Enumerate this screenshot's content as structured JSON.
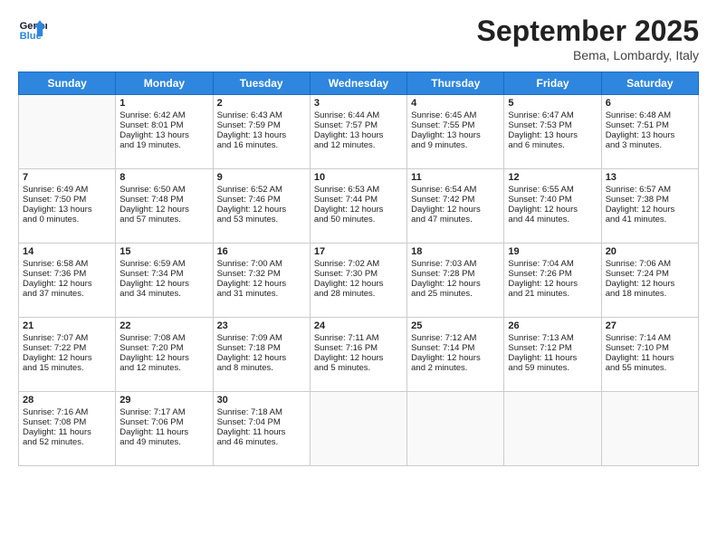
{
  "header": {
    "logo_line1": "General",
    "logo_line2": "Blue",
    "month": "September 2025",
    "location": "Bema, Lombardy, Italy"
  },
  "days_of_week": [
    "Sunday",
    "Monday",
    "Tuesday",
    "Wednesday",
    "Thursday",
    "Friday",
    "Saturday"
  ],
  "weeks": [
    [
      {
        "day": "",
        "content": ""
      },
      {
        "day": "1",
        "content": "Sunrise: 6:42 AM\nSunset: 8:01 PM\nDaylight: 13 hours\nand 19 minutes."
      },
      {
        "day": "2",
        "content": "Sunrise: 6:43 AM\nSunset: 7:59 PM\nDaylight: 13 hours\nand 16 minutes."
      },
      {
        "day": "3",
        "content": "Sunrise: 6:44 AM\nSunset: 7:57 PM\nDaylight: 13 hours\nand 12 minutes."
      },
      {
        "day": "4",
        "content": "Sunrise: 6:45 AM\nSunset: 7:55 PM\nDaylight: 13 hours\nand 9 minutes."
      },
      {
        "day": "5",
        "content": "Sunrise: 6:47 AM\nSunset: 7:53 PM\nDaylight: 13 hours\nand 6 minutes."
      },
      {
        "day": "6",
        "content": "Sunrise: 6:48 AM\nSunset: 7:51 PM\nDaylight: 13 hours\nand 3 minutes."
      }
    ],
    [
      {
        "day": "7",
        "content": "Sunrise: 6:49 AM\nSunset: 7:50 PM\nDaylight: 13 hours\nand 0 minutes."
      },
      {
        "day": "8",
        "content": "Sunrise: 6:50 AM\nSunset: 7:48 PM\nDaylight: 12 hours\nand 57 minutes."
      },
      {
        "day": "9",
        "content": "Sunrise: 6:52 AM\nSunset: 7:46 PM\nDaylight: 12 hours\nand 53 minutes."
      },
      {
        "day": "10",
        "content": "Sunrise: 6:53 AM\nSunset: 7:44 PM\nDaylight: 12 hours\nand 50 minutes."
      },
      {
        "day": "11",
        "content": "Sunrise: 6:54 AM\nSunset: 7:42 PM\nDaylight: 12 hours\nand 47 minutes."
      },
      {
        "day": "12",
        "content": "Sunrise: 6:55 AM\nSunset: 7:40 PM\nDaylight: 12 hours\nand 44 minutes."
      },
      {
        "day": "13",
        "content": "Sunrise: 6:57 AM\nSunset: 7:38 PM\nDaylight: 12 hours\nand 41 minutes."
      }
    ],
    [
      {
        "day": "14",
        "content": "Sunrise: 6:58 AM\nSunset: 7:36 PM\nDaylight: 12 hours\nand 37 minutes."
      },
      {
        "day": "15",
        "content": "Sunrise: 6:59 AM\nSunset: 7:34 PM\nDaylight: 12 hours\nand 34 minutes."
      },
      {
        "day": "16",
        "content": "Sunrise: 7:00 AM\nSunset: 7:32 PM\nDaylight: 12 hours\nand 31 minutes."
      },
      {
        "day": "17",
        "content": "Sunrise: 7:02 AM\nSunset: 7:30 PM\nDaylight: 12 hours\nand 28 minutes."
      },
      {
        "day": "18",
        "content": "Sunrise: 7:03 AM\nSunset: 7:28 PM\nDaylight: 12 hours\nand 25 minutes."
      },
      {
        "day": "19",
        "content": "Sunrise: 7:04 AM\nSunset: 7:26 PM\nDaylight: 12 hours\nand 21 minutes."
      },
      {
        "day": "20",
        "content": "Sunrise: 7:06 AM\nSunset: 7:24 PM\nDaylight: 12 hours\nand 18 minutes."
      }
    ],
    [
      {
        "day": "21",
        "content": "Sunrise: 7:07 AM\nSunset: 7:22 PM\nDaylight: 12 hours\nand 15 minutes."
      },
      {
        "day": "22",
        "content": "Sunrise: 7:08 AM\nSunset: 7:20 PM\nDaylight: 12 hours\nand 12 minutes."
      },
      {
        "day": "23",
        "content": "Sunrise: 7:09 AM\nSunset: 7:18 PM\nDaylight: 12 hours\nand 8 minutes."
      },
      {
        "day": "24",
        "content": "Sunrise: 7:11 AM\nSunset: 7:16 PM\nDaylight: 12 hours\nand 5 minutes."
      },
      {
        "day": "25",
        "content": "Sunrise: 7:12 AM\nSunset: 7:14 PM\nDaylight: 12 hours\nand 2 minutes."
      },
      {
        "day": "26",
        "content": "Sunrise: 7:13 AM\nSunset: 7:12 PM\nDaylight: 11 hours\nand 59 minutes."
      },
      {
        "day": "27",
        "content": "Sunrise: 7:14 AM\nSunset: 7:10 PM\nDaylight: 11 hours\nand 55 minutes."
      }
    ],
    [
      {
        "day": "28",
        "content": "Sunrise: 7:16 AM\nSunset: 7:08 PM\nDaylight: 11 hours\nand 52 minutes."
      },
      {
        "day": "29",
        "content": "Sunrise: 7:17 AM\nSunset: 7:06 PM\nDaylight: 11 hours\nand 49 minutes."
      },
      {
        "day": "30",
        "content": "Sunrise: 7:18 AM\nSunset: 7:04 PM\nDaylight: 11 hours\nand 46 minutes."
      },
      {
        "day": "",
        "content": ""
      },
      {
        "day": "",
        "content": ""
      },
      {
        "day": "",
        "content": ""
      },
      {
        "day": "",
        "content": ""
      }
    ]
  ]
}
